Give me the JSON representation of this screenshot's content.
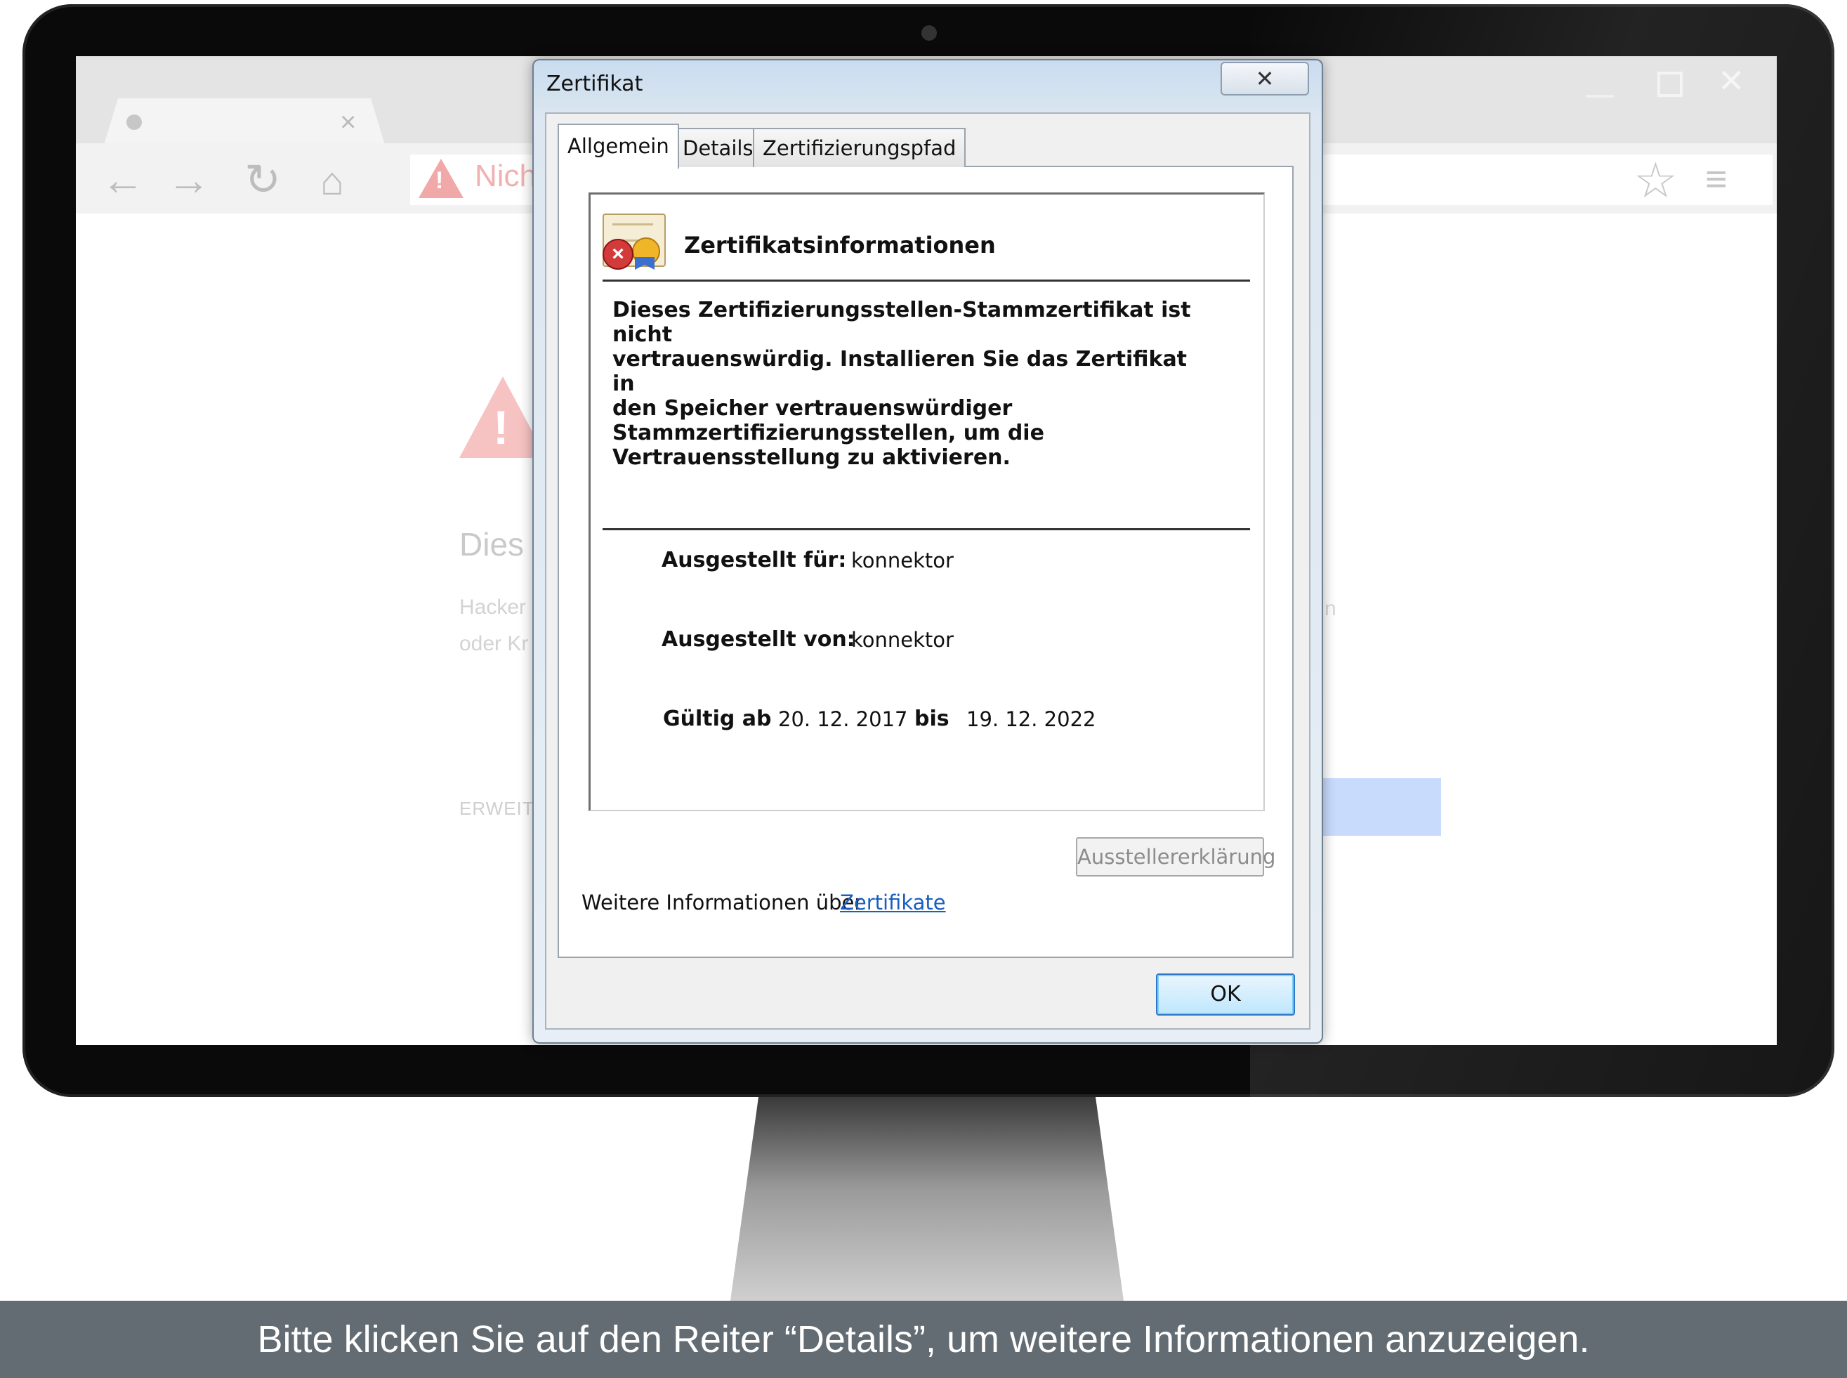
{
  "browser": {
    "omnibox_text": "Nich",
    "error_heading": "Dies",
    "error_line1": "Hacker",
    "error_line2": "oder Kr",
    "error_right_fragment": "n",
    "advanced_link": "ERWEITE"
  },
  "dialog": {
    "title": "Zertifikat",
    "close_glyph": "✕",
    "tabs": [
      {
        "label": "Allgemein",
        "selected": true
      },
      {
        "label": "Details",
        "selected": false
      },
      {
        "label": "Zertifizierungspfad",
        "selected": false
      }
    ],
    "info_heading": "Zertifikatsinformationen",
    "info_message": "Dieses Zertifizierungsstellen-Stammzertifikat ist nicht\nvertrauenswürdig. Installieren Sie das Zertifikat in\nden Speicher vertrauenswürdiger\nStammzertifizierungsstellen, um die\nVertrauensstellung zu aktivieren.",
    "issued_to_label": "Ausgestellt für:",
    "issued_to_value": "konnektor",
    "issued_by_label": "Ausgestellt von:",
    "issued_by_value": "konnektor",
    "valid_from_label": "Gültig ab",
    "valid_from_value": "20. 12. 2017",
    "valid_bis_label": "bis",
    "valid_to_value": "19. 12. 2022",
    "issuer_statement_button": "Ausstellererklärung",
    "issuer_statement_enabled": false,
    "more_info_text": "Weitere Informationen über",
    "more_info_link": "Zertifikate",
    "ok_button": "OK"
  },
  "caption": "Bitte klicken Sie auf den Reiter “Details”, um weitere Informationen anzuzeigen.",
  "colors": {
    "caption_bar": "#636c72",
    "link": "#1a5fbf",
    "error_badge": "#d33a3a"
  },
  "icons": [
    "warning-icon",
    "back-arrow-icon",
    "forward-arrow-icon",
    "reload-icon",
    "home-icon",
    "star-icon",
    "menu-icon",
    "certificate-icon",
    "error-icon"
  ]
}
